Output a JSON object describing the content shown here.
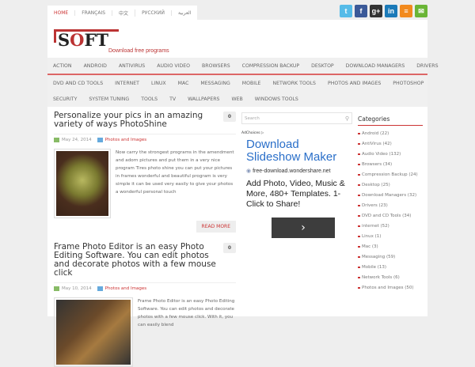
{
  "languages": [
    "HOME",
    "FRANÇAIS",
    "中文",
    "РУССКИЙ",
    "العربية"
  ],
  "social": [
    {
      "name": "twitter",
      "glyph": "t",
      "color": "#55bbe8"
    },
    {
      "name": "facebook",
      "glyph": "f",
      "color": "#3b5998"
    },
    {
      "name": "google-plus",
      "glyph": "g+",
      "color": "#333333"
    },
    {
      "name": "linkedin",
      "glyph": "in",
      "color": "#1b7ab8"
    },
    {
      "name": "rss",
      "glyph": "≡",
      "color": "#f28a1e"
    },
    {
      "name": "email",
      "glyph": "✉",
      "color": "#6ab536"
    }
  ],
  "logo": {
    "text": "SOFT",
    "tagline": "Download free programs"
  },
  "nav": {
    "row1": [
      "ACTION",
      "ANDROID",
      "ANTIVIRUS",
      "AUDIO VIDEO",
      "BROWSERS",
      "COMPRESSION BACKUP",
      "DESKTOP",
      "DOWNLOAD MANAGERS",
      "DRIVERS"
    ],
    "row2": [
      "DVD AND CD TOOLS",
      "INTERNET",
      "LINUX",
      "MAC",
      "MESSAGING",
      "MOBILE",
      "NETWORK TOOLS",
      "PHOTOS AND IMAGES",
      "PHOTOSHOP"
    ],
    "row3": [
      "SECURITY",
      "SYSTEM TUNING",
      "TOOLS",
      "TV",
      "WALLPAPERS",
      "WEB",
      "WINDOWS TOOLS"
    ]
  },
  "posts": [
    {
      "title": "Personalize your pics in an amazing variety of ways PhotoShine",
      "comments": "0",
      "date": "May 24, 2014",
      "category": "Photos and Images",
      "excerpt": "Now carry the strongest programs in the amendment and adorn pictures and put them in a very nice program Tires photo shine you can put your pictures in frames wonderful and beautiful program is very simple it can be used very easily to give your photos a wonderful personal touch",
      "read_more": "READ MORE"
    },
    {
      "title": "Frame Photo Editor is an easy Photo Editing Software. You can edit photos and decorate photos with a few mouse click",
      "comments": "0",
      "date": "May 10, 2014",
      "category": "Photos and Images",
      "excerpt": "Frame Photo Editor is an easy Photo Editing Software. You can edit photos and decorate photos with a few mouse click. With it, you can easily blend"
    }
  ],
  "search": {
    "placeholder": "Search"
  },
  "ad": {
    "adchoices": "AdChoices ▷",
    "title": "Download Slideshow Maker",
    "url": "free-download.wondershare.net",
    "description": "Add Photo, Video, Music & More, 480+ Templates. 1-Click to Share!",
    "button": "›"
  },
  "categories": {
    "title": "Categories",
    "items": [
      "Android (22)",
      "AntiVirus (42)",
      "Audio Video (132)",
      "Browsers (34)",
      "Compression Backup (24)",
      "Desktop (25)",
      "Download Managers (32)",
      "Drivers (23)",
      "DVD and CD Tools (34)",
      "internet (52)",
      "Linux (1)",
      "Mac (3)",
      "Messaging (59)",
      "Mobile (13)",
      "Network Tools (6)",
      "Photos and Images (50)"
    ]
  }
}
